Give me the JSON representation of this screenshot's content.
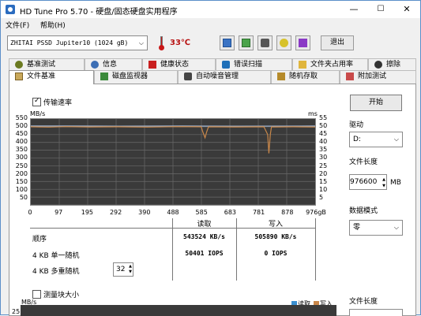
{
  "window": {
    "title": "HD Tune Pro 5.70 - 硬盘/固态硬盘实用程序",
    "minimize": "—",
    "maximize": "☐",
    "close": "✕"
  },
  "menu": [
    "文件(F)",
    "帮助(H)"
  ],
  "toolbar": {
    "drive": "ZHITAI  PSSD Jupiter10 (1024 gB)",
    "temperature": "33℃",
    "exit_label": "退出"
  },
  "tabs_row1": [
    "基准测试",
    "信息",
    "健康状态",
    "错误扫描",
    "文件夹占用率",
    "擦除"
  ],
  "tabs_row2": [
    "文件基准",
    "磁盘监视器",
    "自动噪音管理",
    "随机存取",
    "附加测试"
  ],
  "active_tab": "文件基准",
  "transfer": {
    "checkbox_label": "传输速率",
    "checked": true
  },
  "chart_data": {
    "type": "line",
    "ylabel": "MB/s",
    "ylabel_right": "ms",
    "y_ticks": [
      "550",
      "500",
      "450",
      "400",
      "350",
      "300",
      "250",
      "200",
      "150",
      "100",
      "50"
    ],
    "y_ticks_right": [
      "55",
      "50",
      "45",
      "40",
      "35",
      "30",
      "25",
      "20",
      "15",
      "10",
      "5"
    ],
    "x_ticks": [
      "0",
      "97",
      "195",
      "292",
      "390",
      "488",
      "585",
      "683",
      "781",
      "878",
      "976gB"
    ],
    "ylim": [
      0,
      550
    ],
    "xlim": [
      0,
      976
    ],
    "series": [
      {
        "name": "读取",
        "color": "#9fb3cf",
        "x": [
          0,
          120,
          300,
          520,
          700,
          976
        ],
        "y": [
          505,
          505,
          504,
          505,
          504,
          505
        ]
      },
      {
        "name": "写入",
        "color": "#c8874a",
        "x": [
          0,
          60,
          120,
          200,
          300,
          400,
          500,
          585,
          590,
          598,
          604,
          610,
          700,
          800,
          813,
          817,
          822,
          826,
          830,
          900,
          976
        ],
        "y": [
          500,
          498,
          501,
          499,
          500,
          498,
          501,
          500,
          470,
          430,
          470,
          500,
          499,
          500,
          450,
          330,
          450,
          500,
          499,
          500,
          499
        ]
      }
    ]
  },
  "results": {
    "col_read": "读取",
    "col_write": "写入",
    "rows": [
      {
        "label": "顺序",
        "read": "543524 KB/s",
        "write": "505890 KB/s"
      },
      {
        "label": "4 KB 单一随机",
        "read": "50401 IOPS",
        "write": "0 IOPS"
      },
      {
        "label": "4 KB 多重随机",
        "read": "",
        "write": "",
        "queue": "32"
      }
    ]
  },
  "block_size": {
    "checkbox_label": "测量块大小",
    "checked": false,
    "ylabel": "MB/s",
    "y_top": "25",
    "legend_read": "读取",
    "legend_write": "写入"
  },
  "right_panel": {
    "start_label": "开始",
    "drive_label": "驱动",
    "drive_value": "D:",
    "file_length_label": "文件长度",
    "file_length_value": "976600",
    "file_length_unit": "MB",
    "data_mode_label": "数据模式",
    "data_mode_value": "零",
    "file_length_label2": "文件长度"
  }
}
